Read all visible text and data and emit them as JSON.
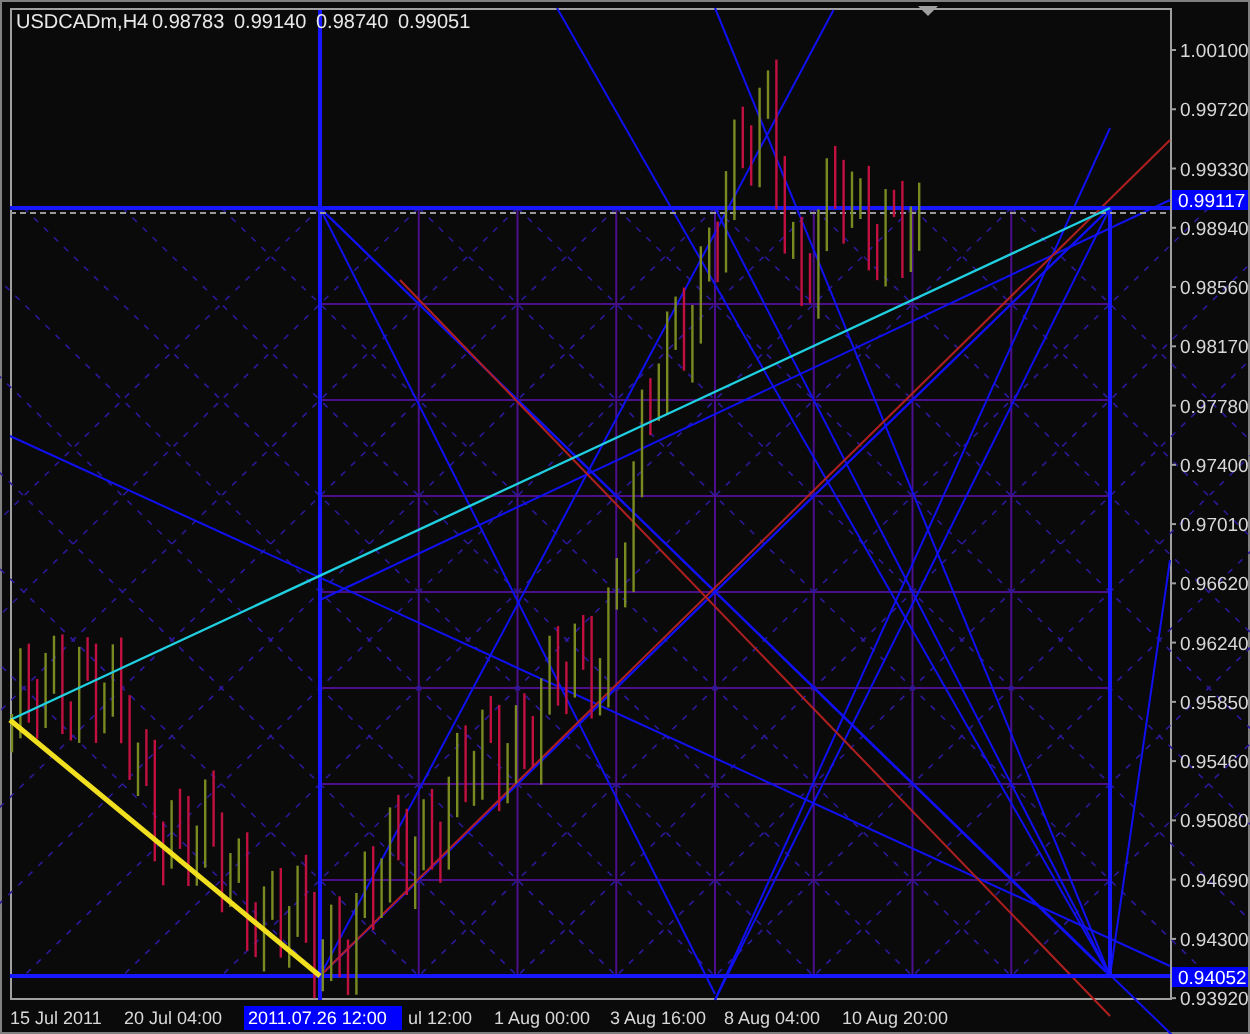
{
  "chart": {
    "symbol": "USDCADm,H4",
    "ohlc": [
      "0.98783",
      "0.99140",
      "0.98740",
      "0.99051"
    ],
    "price_ticks": [
      "1.00100",
      "0.99720",
      "0.99330",
      "0.98940",
      "0.98560",
      "0.98170",
      "0.97780",
      "0.97400",
      "0.97010",
      "0.96620",
      "0.96240",
      "0.95850",
      "0.95460",
      "0.95080",
      "0.94690",
      "0.94300",
      "0.93920"
    ],
    "price_markers": [
      {
        "kind": "level",
        "label": "0.99117"
      },
      {
        "kind": "level",
        "label": "0.94052"
      }
    ],
    "time_ticks": [
      "15 Jul 2011",
      "20 Jul 04:00",
      "ul 12:00",
      "1 Aug 00:00",
      "3 Aug 16:00",
      "8 Aug 04:00",
      "10 Aug 20:00"
    ],
    "time_marker": "2011.07.26 12:00"
  }
}
